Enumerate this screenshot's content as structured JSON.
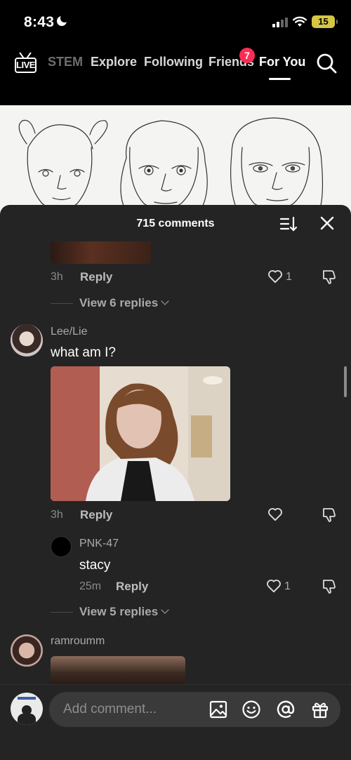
{
  "status_bar": {
    "time": "8:43",
    "battery": "15"
  },
  "nav": {
    "tabs": [
      "STEM",
      "Explore",
      "Following",
      "Friends",
      "For You"
    ],
    "friends_badge": "7",
    "live_label": "LIVE"
  },
  "comments": {
    "header": "715 comments",
    "items": [
      {
        "time": "3h",
        "reply": "Reply",
        "likes": "1",
        "view_replies": "View 6 replies"
      },
      {
        "username": "Lee/Lie",
        "text": "what am I?",
        "time": "3h",
        "reply": "Reply",
        "likes": ""
      },
      {
        "username": "PNK-47",
        "text": "stacy",
        "time": "25m",
        "reply": "Reply",
        "likes": "1",
        "view_replies": "View 5 replies"
      },
      {
        "username": "ramroumm"
      }
    ]
  },
  "composer": {
    "placeholder": "Add comment..."
  },
  "colors": {
    "badge": "#fe2c55",
    "sheet": "#242424",
    "battery": "#d6c644"
  }
}
